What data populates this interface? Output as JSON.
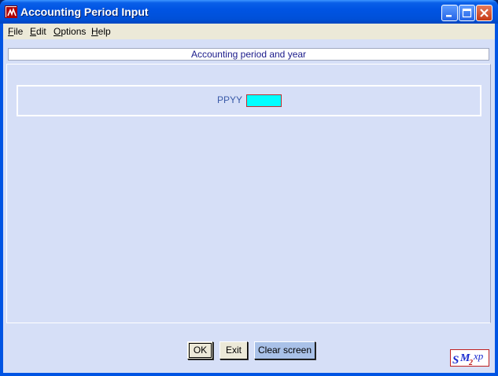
{
  "window": {
    "title": "Accounting Period Input",
    "app_icon": "sm2xp-app-icon",
    "controls": [
      "minimize-icon",
      "maximize-icon",
      "close-icon"
    ]
  },
  "menu": {
    "items": [
      {
        "label": "File"
      },
      {
        "label": "Edit"
      },
      {
        "label": "Options"
      },
      {
        "label": "Help"
      }
    ]
  },
  "header": {
    "title": "Accounting period and year"
  },
  "form": {
    "ppyy_label": "PPYY",
    "ppyy_value": ""
  },
  "buttons": {
    "ok": "OK",
    "exit": "Exit",
    "clear": "Clear screen"
  },
  "logo": {
    "text_s": "S",
    "text_m": "M",
    "text_2": "2",
    "text_xp": "xp"
  },
  "colors": {
    "title_bar": "#0054e3",
    "client_bg": "#d6dff7",
    "input_bg": "#00ffff",
    "header_text": "#1a1a8a",
    "logo_red": "#c02020",
    "logo_blue": "#1a2ad0"
  }
}
